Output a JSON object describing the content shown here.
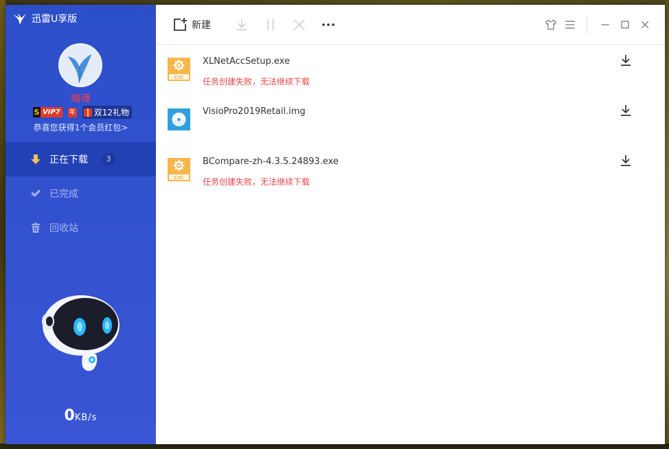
{
  "app": {
    "title": "迅雷U享版"
  },
  "profile": {
    "username": "暗魂",
    "vip_s": "S",
    "vip_level": "VIP7",
    "year_badge": "年",
    "gift_text": "双12礼物",
    "promo": "恭喜您获得1个会员红包>"
  },
  "nav": {
    "items": [
      {
        "label": "正在下载",
        "count": "3",
        "icon": "download-arrow-icon",
        "active": true
      },
      {
        "label": "已完成",
        "icon": "check-icon",
        "active": false
      },
      {
        "label": "回收站",
        "icon": "trash-icon",
        "active": false
      }
    ]
  },
  "speed": {
    "value": "0",
    "unit": "KB/s"
  },
  "toolbar": {
    "new_label": "新建"
  },
  "tasks": [
    {
      "name": "XLNetAccSetup.exe",
      "status": "任务创建失败，无法继续下载",
      "type": "exe",
      "type_label": "EXE"
    },
    {
      "name": "VisioPro2019Retail.img",
      "status": "",
      "type": "img"
    },
    {
      "name": "BCompare-zh-4.3.5.24893.exe",
      "status": "任务创建失败，无法继续下载",
      "type": "exe",
      "type_label": "EXE"
    }
  ],
  "colors": {
    "sidebar": "#2c4fc9",
    "active_nav": "#2241b5",
    "error": "#e8464b",
    "exe_icon": "#f7b54a",
    "img_icon": "#2fa0e0"
  }
}
